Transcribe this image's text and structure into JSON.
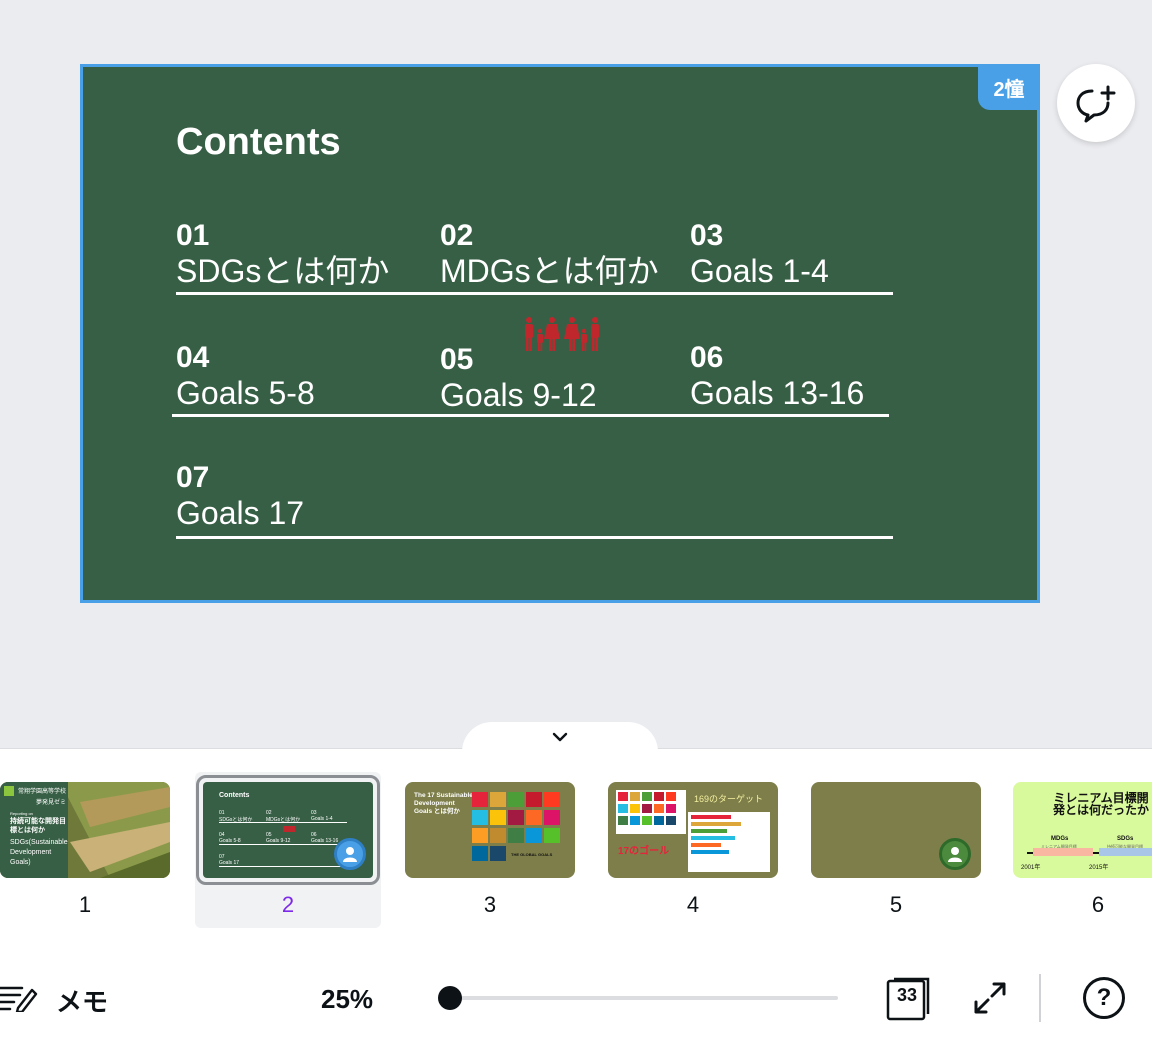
{
  "slide": {
    "badge": "2憧",
    "title": "Contents",
    "items": [
      {
        "num": "01",
        "label": "SDGsとは何か"
      },
      {
        "num": "02",
        "label": "MDGsとは何か"
      },
      {
        "num": "03",
        "label": " Goals 1-4"
      },
      {
        "num": "04",
        "label": "Goals 5-8"
      },
      {
        "num": "05",
        "label": "Goals 9-12"
      },
      {
        "num": "06",
        "label": " Goals 13-16"
      },
      {
        "num": "07",
        "label": "Goals 17"
      }
    ]
  },
  "thumbnails": [
    {
      "number": "1",
      "school": "常翔学園高等学校",
      "seminar": "夢発見ゼミ",
      "reporting": "Reporting on",
      "title": "持続可能な開発目標とは何か",
      "sub": "SDGs(Sustainable Development Goals)"
    },
    {
      "number": "2",
      "title": "Contents",
      "items": [
        "01",
        "SDGsとは何か",
        "02",
        "MDGsとは何か",
        "03",
        "Goals 1-4",
        "04",
        "Goals 5-8",
        "05",
        "Goals 9-12",
        "06",
        "Goals 13-16",
        "07",
        "Goals 17"
      ]
    },
    {
      "number": "3",
      "title": "The 17 Sustainable Development Goals とは何か",
      "tag": "THE GLOBAL GOALS"
    },
    {
      "number": "4",
      "title": "169のターゲット",
      "sub": "17のゴール"
    },
    {
      "number": "5"
    },
    {
      "number": "6",
      "title": "ミレニアム目標開発とは何だったか",
      "mdgs": "MDGs",
      "sdgs": "SDGs",
      "mdgs_sub": "ミレニアム開発目標",
      "sdgs_sub": "持続可能な開発目標",
      "y1": "2001年",
      "y2": "2015年"
    }
  ],
  "footer": {
    "memo": "メモ",
    "zoom": "25%",
    "zoom_value": 0.0,
    "pages": "33"
  },
  "colors": {
    "slide_bg": "#375f45",
    "selection": "#4aa0e6",
    "selected_page_num": "#7d2ae8"
  }
}
